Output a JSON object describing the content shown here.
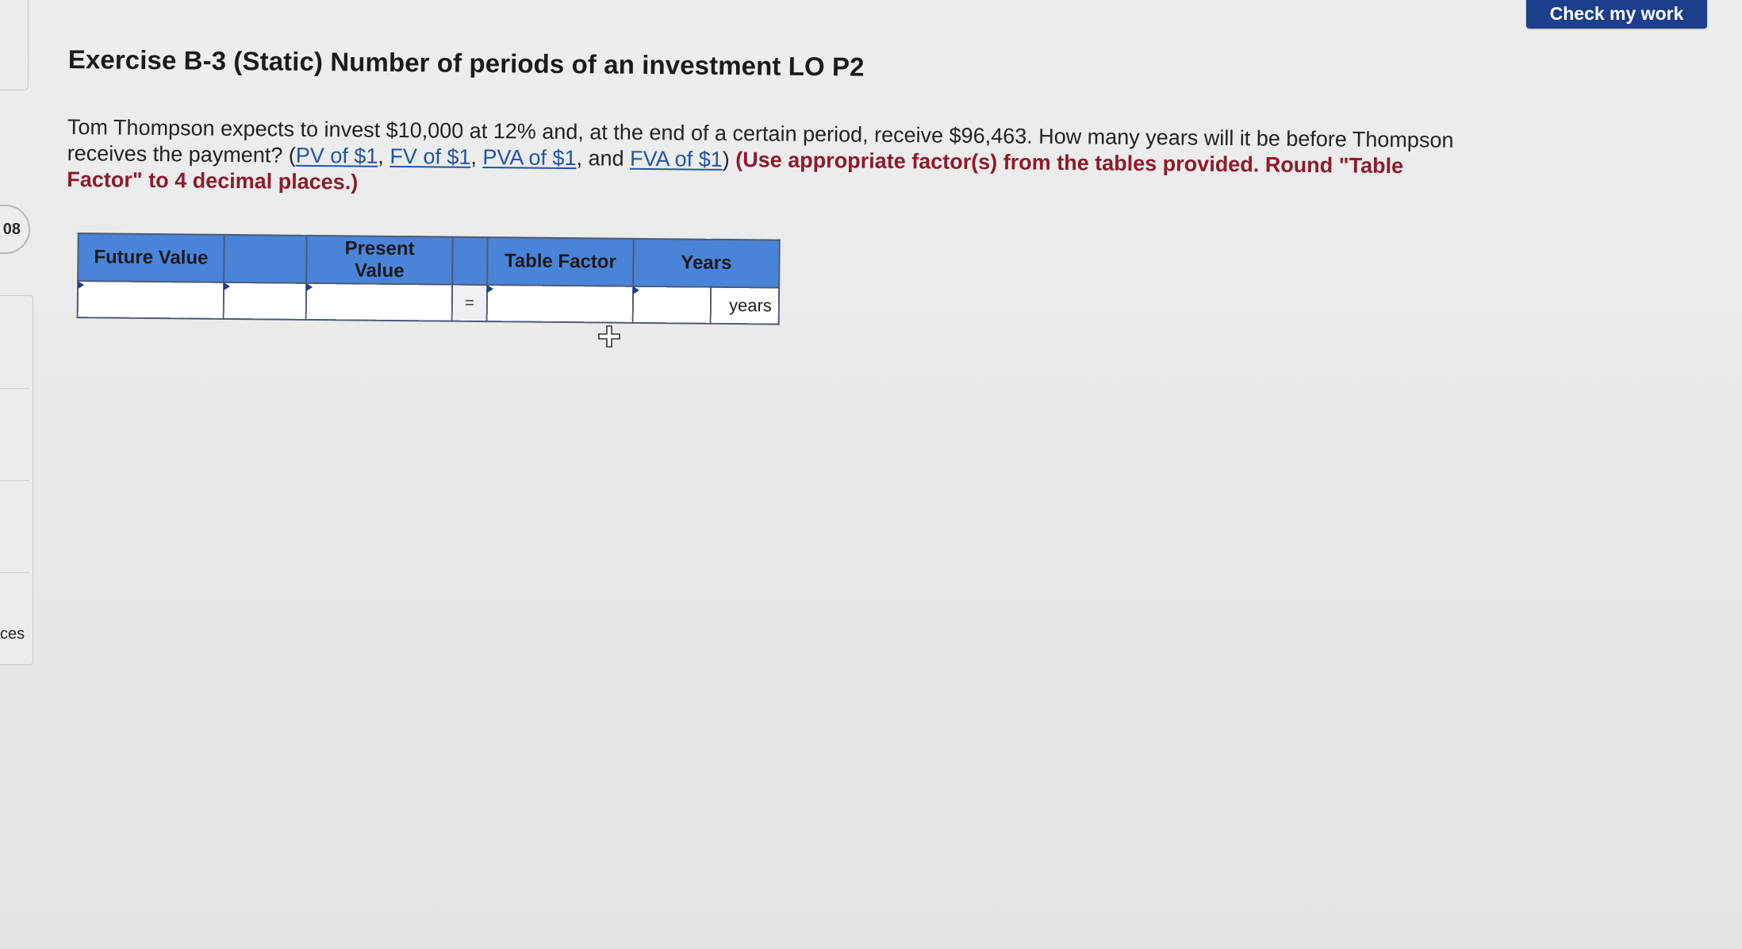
{
  "header": {
    "check_button_label": "Check my work"
  },
  "sidebar": {
    "badge_text": "08",
    "bottom_label": "ces"
  },
  "exercise": {
    "title": "Exercise B-3 (Static) Number of periods of an investment LO P2",
    "question_prefix": "Tom Thompson expects to invest $10,000 at 12% and, at the end of a certain period, receive $96,463. How many years will it be before Thompson receives the payment? (",
    "links": [
      {
        "label": "PV of $1"
      },
      {
        "label": "FV of $1"
      },
      {
        "label": "PVA of $1"
      },
      {
        "label": "FVA of $1"
      }
    ],
    "sep_1": ", ",
    "sep_2": ", ",
    "sep_3": ", and ",
    "links_close": ")",
    "instruction": " (Use appropriate factor(s) from the tables provided. Round \"Table Factor\" to 4 decimal places.)"
  },
  "worksheet": {
    "headers": {
      "future_value": "Future Value",
      "present_value": "Present Value",
      "table_factor": "Table Factor",
      "years": "Years"
    },
    "row": {
      "future_value": "",
      "operator_select": "",
      "present_value": "",
      "equals": "=",
      "table_factor": "",
      "years": "",
      "unit": "years"
    }
  },
  "colors": {
    "header_blue": "#4a84d8",
    "button_navy": "#1c3f8c",
    "link_blue": "#2153a5",
    "instruction_red": "#8e1b2c"
  },
  "icons": {
    "cursor": "crosshair-cursor-icon"
  }
}
